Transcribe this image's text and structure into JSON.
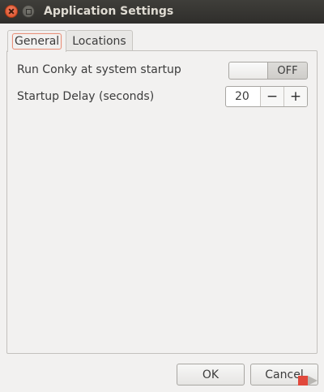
{
  "window": {
    "title": "Application Settings"
  },
  "tabs": [
    {
      "label": "General",
      "active": true
    },
    {
      "label": "Locations",
      "active": false
    }
  ],
  "general": {
    "startup_label": "Run Conky at system startup",
    "startup_switch_state": "OFF",
    "delay_label": "Startup Delay (seconds)",
    "delay_value": "20",
    "decrement_symbol": "−",
    "increment_symbol": "+"
  },
  "buttons": {
    "ok_label": "OK",
    "cancel_label": "Cancel"
  },
  "colors": {
    "close_button": "#d9491c",
    "titlebar": "#3f3e3a",
    "tab_focus": "#e8917a"
  }
}
